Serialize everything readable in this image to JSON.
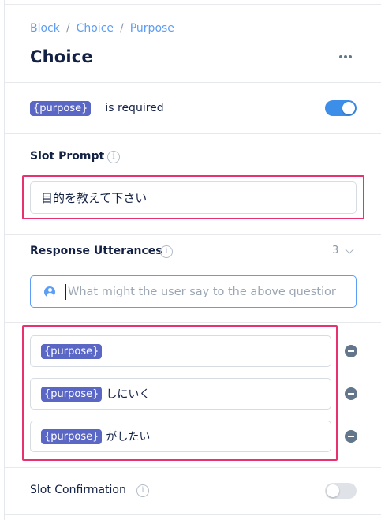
{
  "breadcrumb": {
    "items": [
      "Block",
      "Choice",
      "Purpose"
    ],
    "separator": "/"
  },
  "header": {
    "title": "Choice",
    "more_icon": "more-horizontal-icon"
  },
  "required": {
    "slot_chip": "{purpose}",
    "text": "is required",
    "toggle_on": true
  },
  "slot_prompt": {
    "label": "Slot Prompt",
    "info_icon": "info-icon",
    "value": "目的を教えて下さい"
  },
  "responses": {
    "label": "Response Utterances",
    "info_icon": "info-icon",
    "count": "3",
    "collapse_icon": "chevron-down-icon",
    "input_placeholder": "What might the user say to the above question?",
    "items": [
      {
        "chip": "{purpose}",
        "text": ""
      },
      {
        "chip": "{purpose}",
        "text": "しにいく"
      },
      {
        "chip": "{purpose}",
        "text": "がしたい"
      }
    ]
  },
  "slot_confirmation": {
    "label": "Slot Confirmation",
    "info_icon": "info-icon",
    "toggle_on": false
  },
  "colors": {
    "accent": "#3d8ee8",
    "link": "#5d9df5",
    "chip": "#5b67c5",
    "highlight": "#e8326f",
    "text": "#132144"
  }
}
